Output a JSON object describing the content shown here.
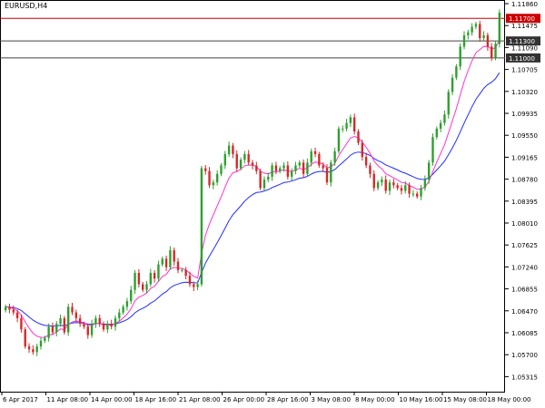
{
  "window": {
    "symbol_label": "EURUSD,H4"
  },
  "colors": {
    "background": "#ffffff",
    "frame": "#000000",
    "bull_candle": "#2ca02c",
    "bear_candle": "#d62728",
    "ma_fast": "#ff33cc",
    "ma_slow": "#1f2dff",
    "hline_red": "#cc0000",
    "hline_dark": "#444444",
    "price_tag_bg": "#333333",
    "price_tag_text": "#ffffff"
  },
  "price_scale": {
    "labels": [
      "1.11860",
      "1.11475",
      "1.11090",
      "1.10705",
      "1.10320",
      "1.09935",
      "1.09550",
      "1.09165",
      "1.08780",
      "1.08395",
      "1.08010",
      "1.07625",
      "1.07240",
      "1.06855",
      "1.06470",
      "1.06085",
      "1.05700",
      "1.05315"
    ]
  },
  "time_scale": {
    "labels": [
      "6 Apr 2017",
      "11 Apr 08:00",
      "14 Apr 00:00",
      "18 Apr 16:00",
      "21 Apr 08:00",
      "26 Apr 00:00",
      "28 Apr 16:00",
      "3 May 08:00",
      "8 May 00:00",
      "10 May 16:00",
      "15 May 08:00",
      "18 May 00:00"
    ]
  },
  "horizontal_lines": [
    {
      "price": 1.117,
      "label": "1.11700",
      "color": "red"
    },
    {
      "price": 1.113,
      "label": "1.11300",
      "color": "dark"
    },
    {
      "price": 1.11,
      "label": "1.11000",
      "color": "dark"
    }
  ],
  "chart_data": {
    "type": "candlestick",
    "symbol": "EURUSD",
    "timeframe": "H4",
    "ylim": [
      1.051,
      1.1196
    ],
    "grid": false,
    "closes": [
      1.066,
      1.0655,
      1.065,
      1.064,
      1.062,
      1.059,
      1.0585,
      1.058,
      1.059,
      1.06,
      1.0605,
      1.0625,
      1.0615,
      1.063,
      1.064,
      1.0615,
      1.066,
      1.065,
      1.064,
      1.063,
      1.0625,
      1.061,
      1.063,
      1.064,
      1.063,
      1.062,
      1.063,
      1.0625,
      1.064,
      1.065,
      1.066,
      1.067,
      1.069,
      1.072,
      1.07,
      1.069,
      1.07,
      1.072,
      1.071,
      1.0735,
      1.0745,
      1.073,
      1.076,
      1.074,
      1.0725,
      1.0725,
      1.0715,
      1.07,
      1.0695,
      1.07,
      1.0905,
      1.09,
      1.0875,
      1.088,
      1.0895,
      1.091,
      1.093,
      1.0945,
      1.093,
      1.0905,
      1.092,
      1.093,
      1.0915,
      1.091,
      1.09,
      1.087,
      1.0885,
      1.089,
      1.091,
      1.09,
      1.0905,
      1.091,
      1.089,
      1.09,
      1.091,
      1.0915,
      1.0895,
      1.0915,
      1.0935,
      1.093,
      1.091,
      1.0905,
      1.088,
      1.0915,
      1.0935,
      1.0975,
      1.0975,
      1.0985,
      1.0995,
      1.097,
      1.095,
      1.0925,
      1.091,
      1.0895,
      1.087,
      1.088,
      1.0885,
      1.0865,
      1.088,
      1.0875,
      1.087,
      1.0865,
      1.0875,
      1.086,
      1.086,
      1.0855,
      1.087,
      1.0885,
      1.0915,
      1.096,
      1.0975,
      1.0985,
      1.1,
      1.104,
      1.1065,
      1.1085,
      1.112,
      1.114,
      1.1145,
      1.1155,
      1.116,
      1.1135,
      1.114,
      1.112,
      1.11,
      1.1125,
      1.118
    ]
  }
}
